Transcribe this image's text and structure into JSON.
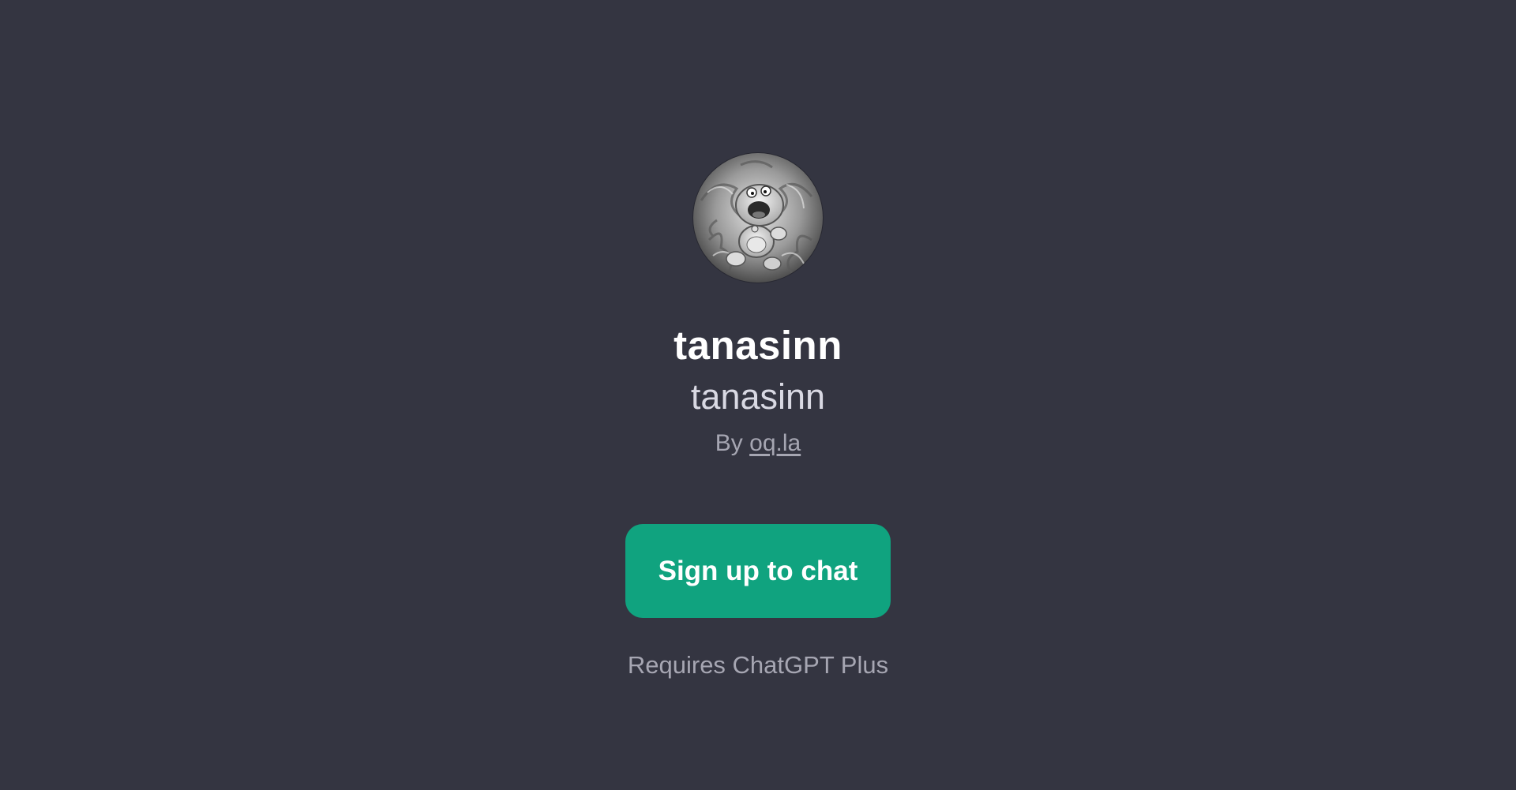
{
  "gpt": {
    "name": "tanasinn",
    "description": "tanasinn",
    "by_prefix": "By",
    "author": "oq.la",
    "avatar_icon": "swirling-creature-portrait"
  },
  "cta": {
    "signup_label": "Sign up to chat",
    "requirement": "Requires ChatGPT Plus"
  },
  "colors": {
    "background": "#343541",
    "accent": "#10a37f",
    "title": "#ffffff",
    "muted": "#a6a6b2"
  }
}
